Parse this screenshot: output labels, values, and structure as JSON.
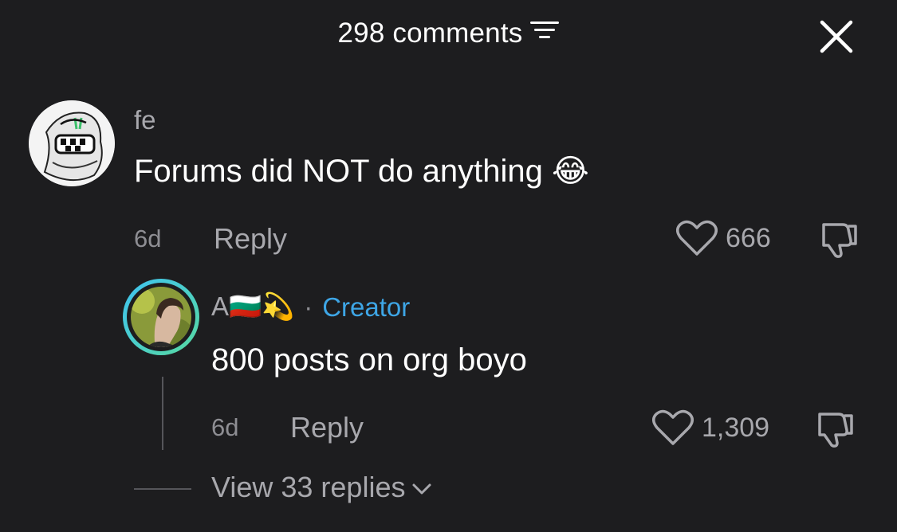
{
  "header": {
    "title": "298 comments",
    "sort_icon": "sort-lines-icon",
    "close_icon": "close-icon"
  },
  "comments": [
    {
      "username": "fe",
      "text": "Forums did NOT do anything 😂",
      "time": "6d",
      "reply_label": "Reply",
      "likes": "666"
    }
  ],
  "reply": {
    "username": "A🇧🇬💫",
    "separator": "·",
    "creator_label": "Creator",
    "text": "800 posts on org boyo",
    "time": "6d",
    "reply_label": "Reply",
    "likes": "1,309"
  },
  "view_replies_label": "View 33 replies",
  "colors": {
    "background": "#1d1d1f",
    "creator": "#3ea6e6",
    "muted": "#a8a8ad",
    "ring_gradient": [
      "#46c6f0",
      "#5ad7a0"
    ]
  }
}
